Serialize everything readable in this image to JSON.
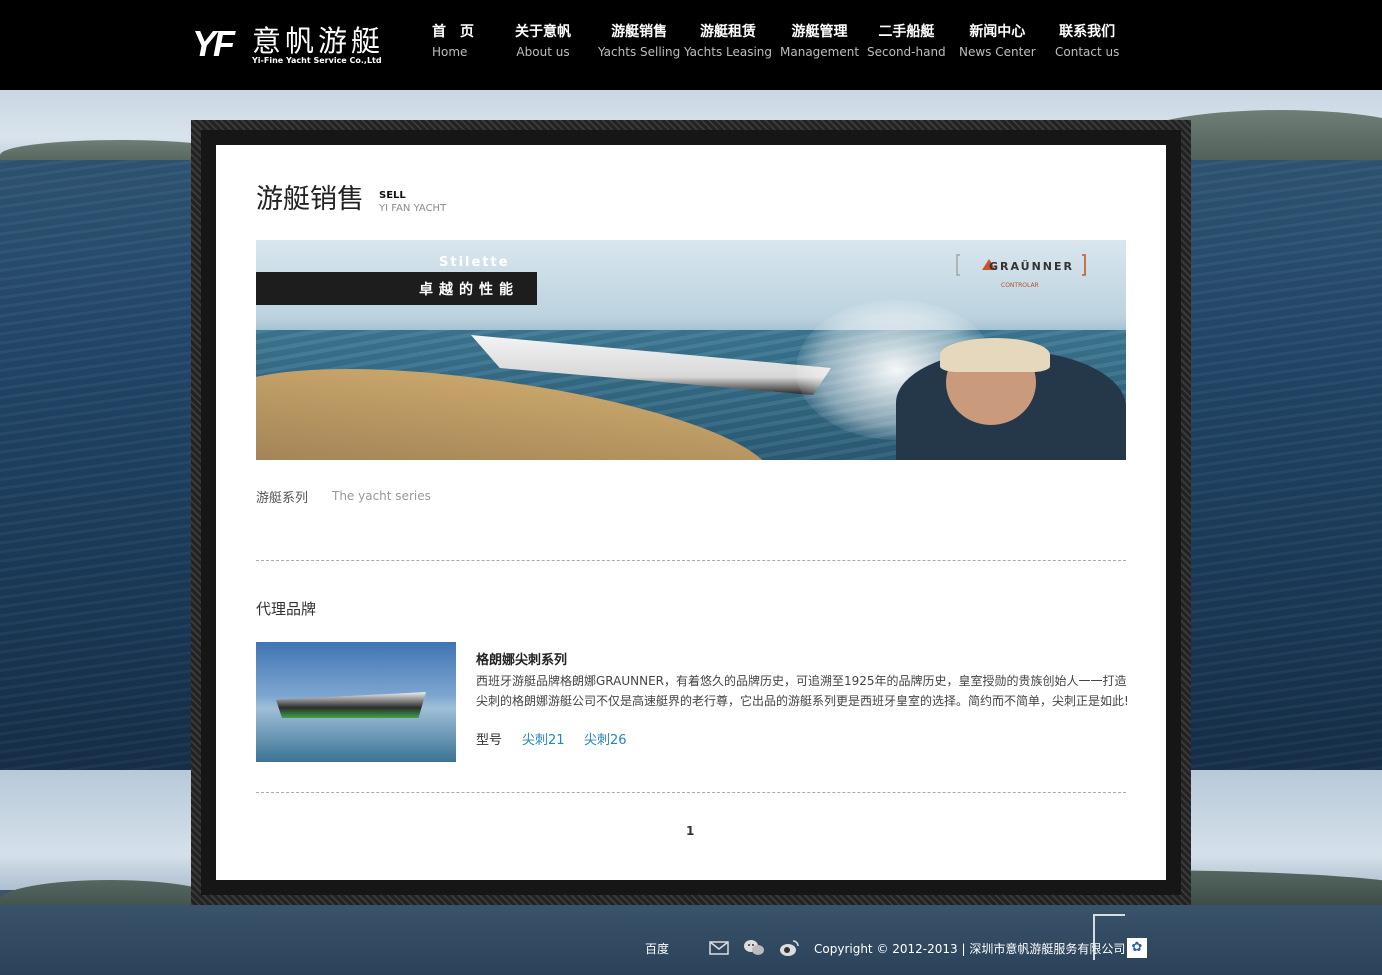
{
  "logo": {
    "mark": "YF",
    "name_cn": "意帆游艇",
    "name_en": "Yi-Fine Yacht Service Co.,Ltd"
  },
  "nav": [
    {
      "cn": "首　页",
      "en": "Home"
    },
    {
      "cn": "关于意帆",
      "en": "About us"
    },
    {
      "cn": "游艇销售",
      "en": "Yachts Selling"
    },
    {
      "cn": "游艇租赁",
      "en": "Yachts Leasing"
    },
    {
      "cn": "游艇管理",
      "en": "Management"
    },
    {
      "cn": "二手船艇",
      "en": "Second-hand"
    },
    {
      "cn": "新闻中心",
      "en": "News Center"
    },
    {
      "cn": "联系我们",
      "en": "Contact us"
    }
  ],
  "page": {
    "title_cn": "游艇销售",
    "title_sell": "SELL",
    "title_en": "YI FAN YACHT"
  },
  "banner": {
    "tag_top": "Stilette",
    "tag_text": "卓越的性能",
    "brand": "GRAÜNNER",
    "brand_sub": "CONTROLAR"
  },
  "series": {
    "cn": "游艇系列",
    "en": "The yacht series"
  },
  "brand_section": {
    "title": "代理品牌",
    "item_title": "格朗娜尖刺系列",
    "item_desc": "西班牙游艇品牌格朗娜GRAUNNER，有着悠久的品牌历史，可追溯至1925年的品牌历史，皇室授勋的贵族创始人一一打造尖刺的格朗娜游艇公司不仅是高速艇界的老行尊，它出品的游艇系列更是西班牙皇室的选择。简约而不简单，尖刺正是如此!",
    "model_label": "型号",
    "models": [
      "尖刺21",
      "尖刺26"
    ]
  },
  "pagination": {
    "current": "1"
  },
  "footer": {
    "baidu": "百度",
    "copyright": "Copyright © 2012-2013 | 深圳市意帆游艇服务有限公司",
    "icons": [
      "mail-icon",
      "wechat-icon",
      "weibo-icon",
      "baidu-paw-icon"
    ]
  },
  "colors": {
    "header_bg": "#000000",
    "link": "#2486b9",
    "panel_bg": "#ffffff"
  }
}
